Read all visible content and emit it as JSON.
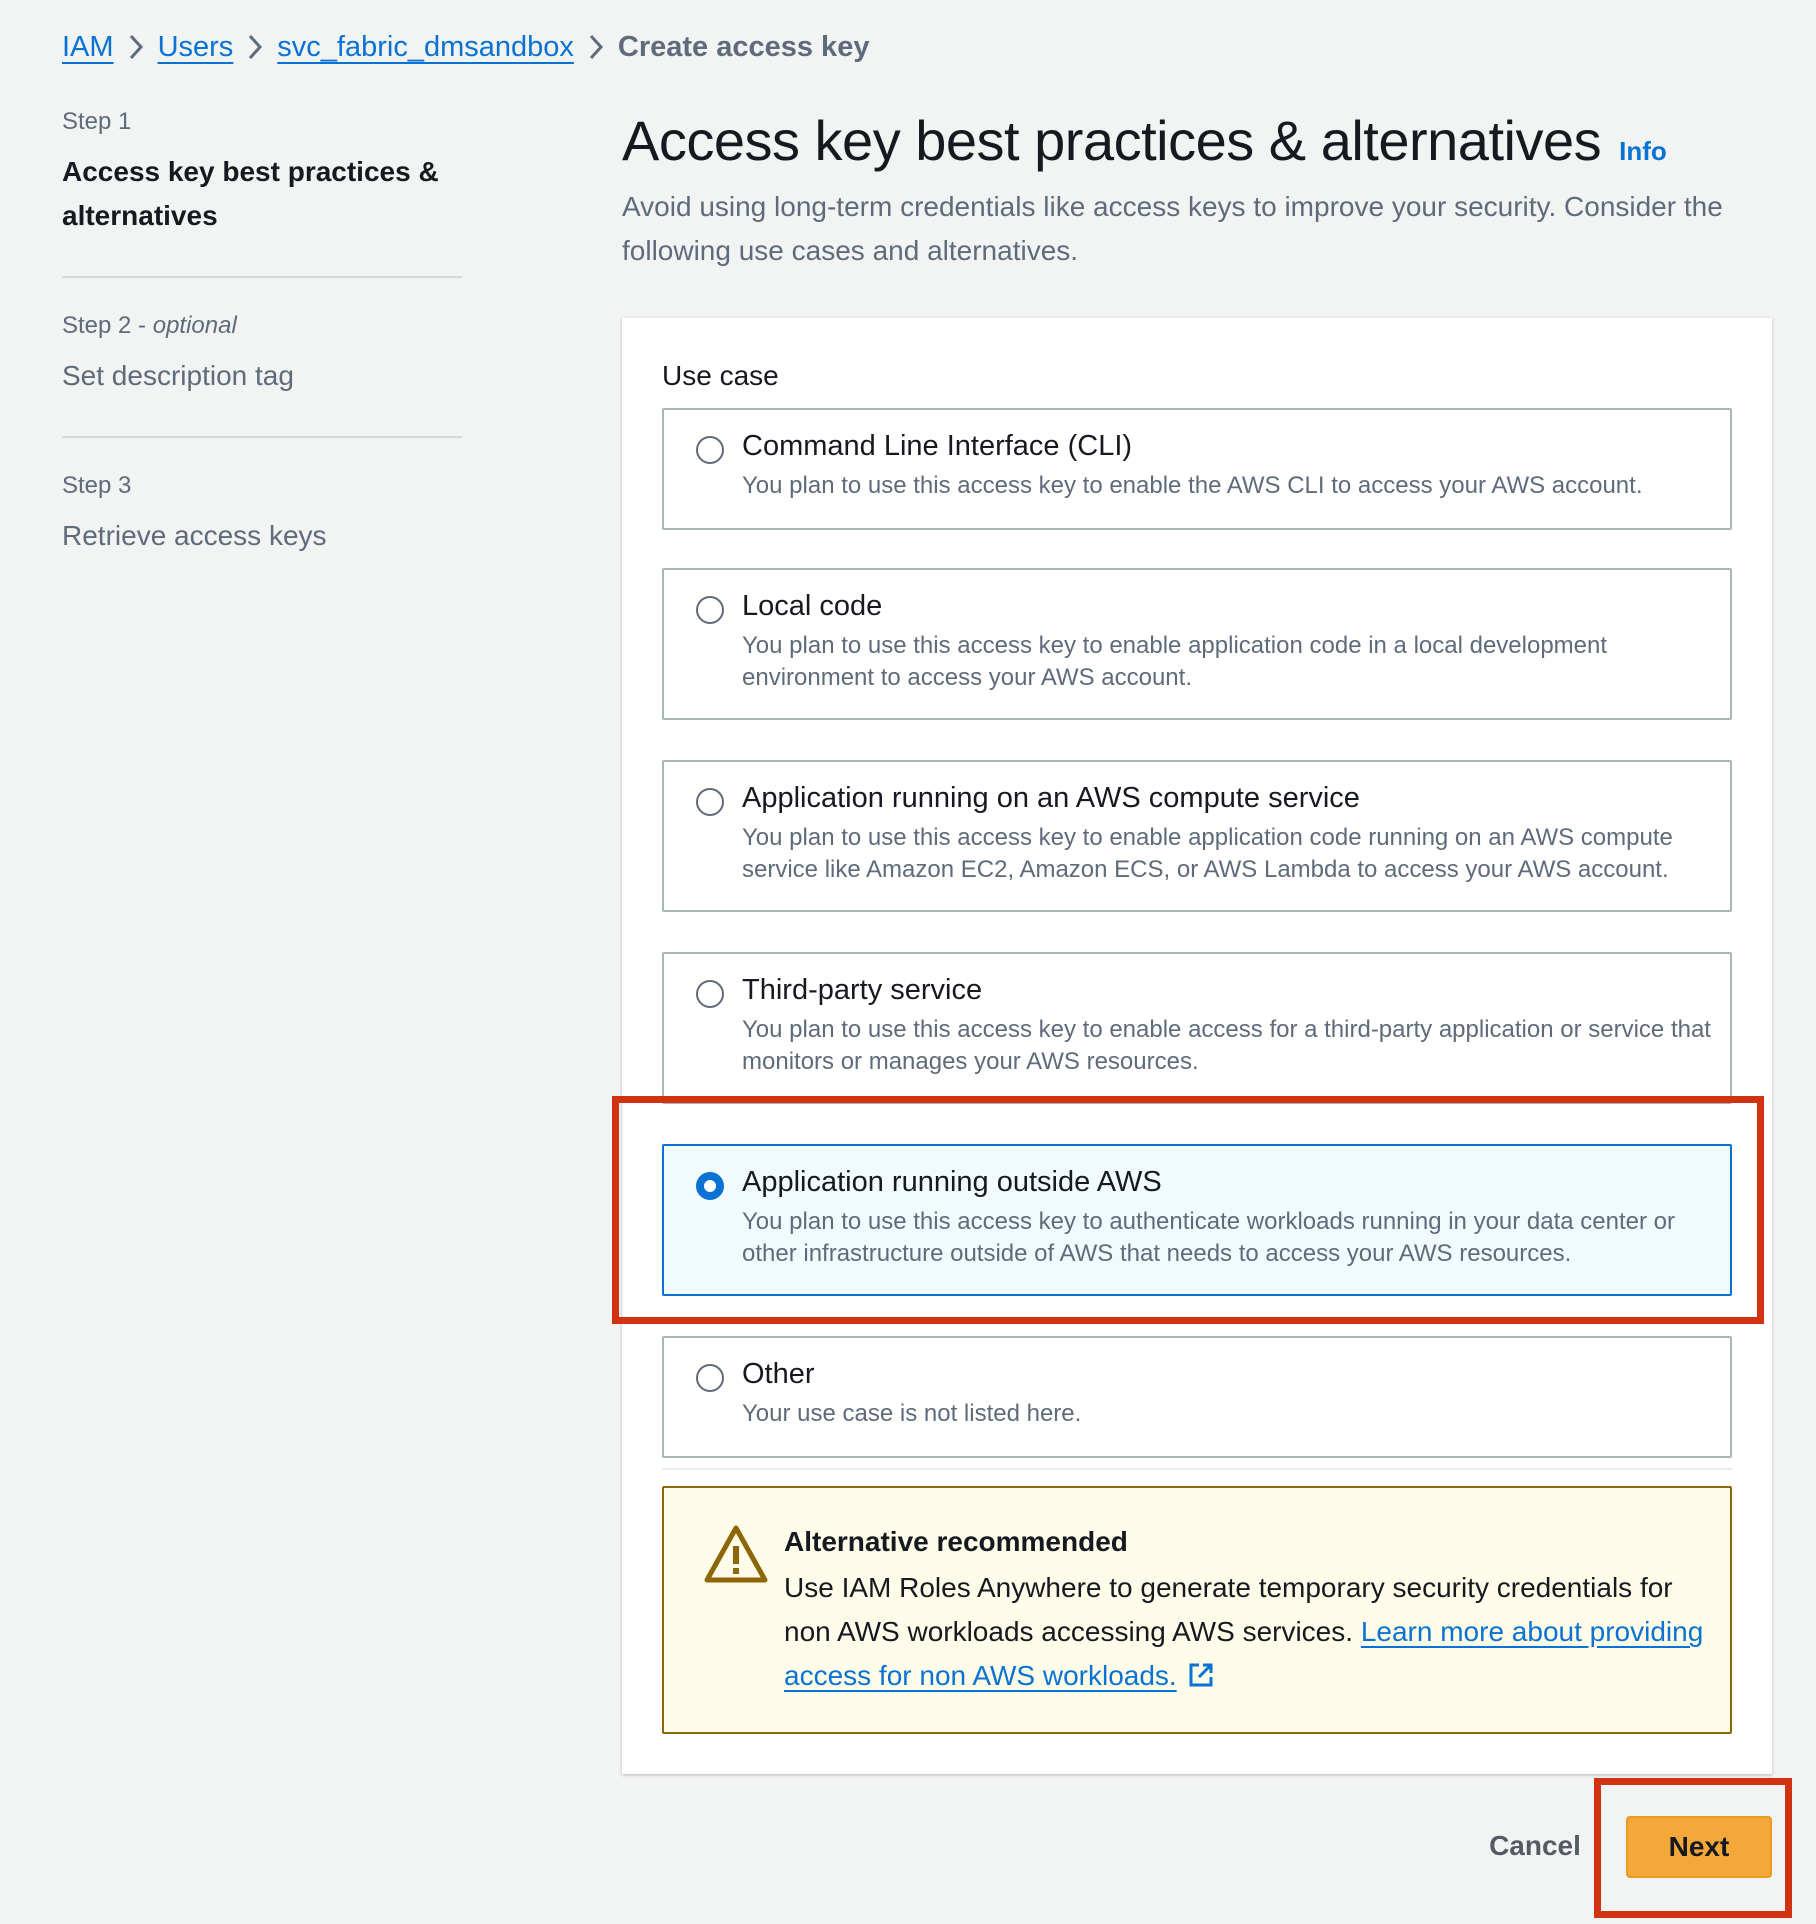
{
  "breadcrumb": {
    "iam": "IAM",
    "users": "Users",
    "user": "svc_fabric_dmsandbox",
    "current": "Create access key"
  },
  "steps": [
    {
      "num": "Step 1",
      "optional": "",
      "title": "Access key best practices & alternatives",
      "active": true
    },
    {
      "num": "Step 2 - ",
      "optional": "optional",
      "title": "Set description tag",
      "active": false
    },
    {
      "num": "Step 3",
      "optional": "",
      "title": "Retrieve access keys",
      "active": false
    }
  ],
  "page": {
    "title": "Access key best practices & alternatives",
    "info": "Info",
    "description": "Avoid using long-term credentials like access keys to improve your security. Consider the following use cases and alternatives."
  },
  "use_case": {
    "label": "Use case",
    "options": [
      {
        "title": "Command Line Interface (CLI)",
        "description": "You plan to use this access key to enable the AWS CLI to access your AWS account.",
        "selected": false
      },
      {
        "title": "Local code",
        "description": "You plan to use this access key to enable application code in a local development environment to access your AWS account.",
        "selected": false
      },
      {
        "title": "Application running on an AWS compute service",
        "description": "You plan to use this access key to enable application code running on an AWS compute service like Amazon EC2, Amazon ECS, or AWS Lambda to access your AWS account.",
        "selected": false
      },
      {
        "title": "Third-party service",
        "description": "You plan to use this access key to enable access for a third-party application or service that monitors or manages your AWS resources.",
        "selected": false
      },
      {
        "title": "Application running outside AWS",
        "description": "You plan to use this access key to authenticate workloads running in your data center or other infrastructure outside of AWS that needs to access your AWS resources.",
        "selected": true
      },
      {
        "title": "Other",
        "description": "Your use case is not listed here.",
        "selected": false
      }
    ]
  },
  "alert": {
    "title": "Alternative recommended",
    "body": "Use IAM Roles Anywhere to generate temporary security credentials for non AWS workloads accessing AWS services. ",
    "link": "Learn more about providing access for non AWS workloads."
  },
  "actions": {
    "cancel": "Cancel",
    "next": "Next"
  },
  "colors": {
    "accent": "#0972d3",
    "primary_button": "#f4a83a",
    "highlight": "#d13212",
    "warning_border": "#8d6605"
  }
}
